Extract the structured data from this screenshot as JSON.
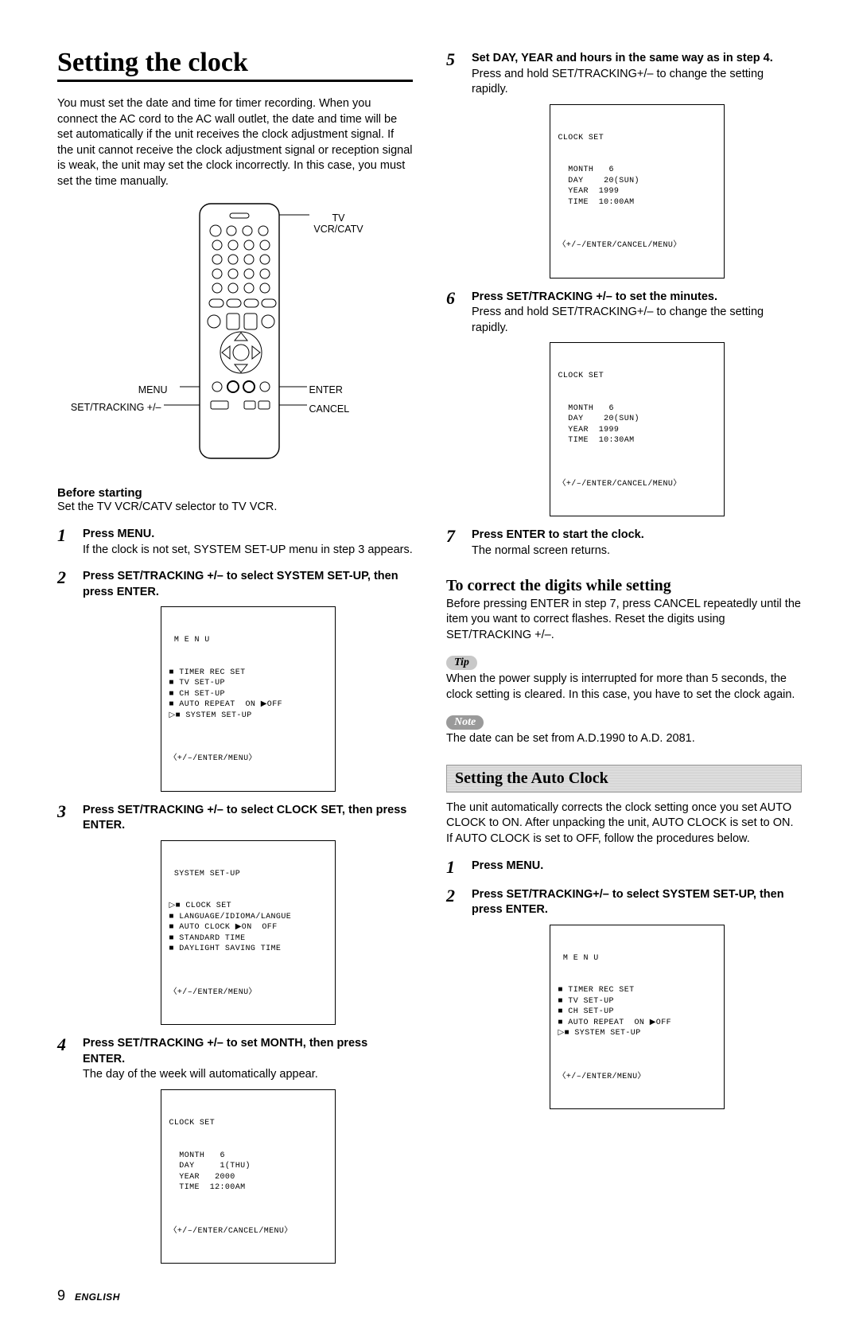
{
  "left": {
    "title": "Setting the clock",
    "intro": "You must set the date and time for timer recording. When you connect the AC cord to the AC wall outlet, the date and time will be set automatically if the unit receives the clock adjustment signal. If the unit cannot receive the clock adjustment signal or reception signal is weak, the unit may set the clock incorrectly. In this case, you must set the time manually.",
    "labels": {
      "tvvcr": "TV VCR/CATV",
      "menu": "MENU",
      "settracking": "SET/TRACKING +/–",
      "enter": "ENTER",
      "cancel": "CANCEL"
    },
    "before_heading": "Before starting",
    "before_text": "Set the TV VCR/CATV selector to TV VCR.",
    "steps": [
      {
        "n": "1",
        "title": "Press MENU.",
        "body": "If the clock is not set, SYSTEM SET-UP menu in step 3 appears."
      },
      {
        "n": "2",
        "title": "Press SET/TRACKING +/– to select SYSTEM SET-UP, then press ENTER.",
        "body": ""
      },
      {
        "n": "3",
        "title": "Press SET/TRACKING +/– to select CLOCK SET, then press ENTER.",
        "body": ""
      },
      {
        "n": "4",
        "title": "Press SET/TRACKING +/– to set MONTH, then press ENTER.",
        "body": "The day of the week will automatically appear."
      }
    ],
    "osd_menu": {
      "head": " M E N U",
      "lines": "■ TIMER REC SET\n■ TV SET-UP\n■ CH SET-UP\n■ AUTO REPEAT  ON ▶OFF\n▷■ SYSTEM SET-UP",
      "footer": "〈+/–/ENTER/MENU〉"
    },
    "osd_system": {
      "head": " SYSTEM SET-UP",
      "lines": "▷■ CLOCK SET\n■ LANGUAGE/IDIOMA/LANGUE\n■ AUTO CLOCK ▶ON  OFF\n■ STANDARD TIME\n■ DAYLIGHT SAVING TIME",
      "footer": "〈+/–/ENTER/MENU〉"
    },
    "osd_clock4": {
      "head": "CLOCK SET",
      "lines": "  MONTH   6\n  DAY     1(THU)\n  YEAR   2000\n  TIME  12:00AM",
      "footer": "〈+/–/ENTER/CANCEL/MENU〉"
    }
  },
  "right": {
    "steps": [
      {
        "n": "5",
        "title": "Set DAY, YEAR and hours in the same way as in step 4.",
        "body": "Press and hold SET/TRACKING+/– to change the setting rapidly."
      },
      {
        "n": "6",
        "title": "Press SET/TRACKING +/– to set the minutes.",
        "body": "Press and hold SET/TRACKING+/– to change the setting rapidly."
      },
      {
        "n": "7",
        "title": "Press ENTER to start the clock.",
        "body": "The normal screen returns."
      }
    ],
    "osd_clock5": {
      "head": "CLOCK SET",
      "lines": "  MONTH   6\n  DAY    20(SUN)\n  YEAR  1999\n  TIME  10:00AM",
      "footer": "〈+/–/ENTER/CANCEL/MENU〉"
    },
    "osd_clock6": {
      "head": "CLOCK SET",
      "lines": "  MONTH   6\n  DAY    20(SUN)\n  YEAR  1999\n  TIME  10:30AM",
      "footer": "〈+/–/ENTER/CANCEL/MENU〉"
    },
    "correct_heading": "To correct the digits while setting",
    "correct_body": "Before pressing ENTER in step 7, press CANCEL repeatedly until the item you want to correct flashes.  Reset the digits using SET/TRACKING +/–.",
    "tip_label": "Tip",
    "tip_body": "When the power supply is interrupted for more than 5 seconds, the clock setting is cleared. In this case, you have to set the clock again.",
    "note_label": "Note",
    "note_body": "The date can be set from A.D.1990 to A.D. 2081.",
    "auto_heading": "Setting the Auto Clock",
    "auto_body": "The unit automatically corrects the clock setting once you set AUTO CLOCK to ON.  After unpacking the unit, AUTO CLOCK is set to ON.\nIf AUTO CLOCK is set to OFF, follow the procedures below.",
    "auto_steps": [
      {
        "n": "1",
        "title": "Press MENU.",
        "body": ""
      },
      {
        "n": "2",
        "title": "Press SET/TRACKING+/– to select SYSTEM SET-UP, then press ENTER.",
        "body": ""
      }
    ],
    "osd_menu2": {
      "head": " M E N U",
      "lines": "■ TIMER REC SET\n■ TV SET-UP\n■ CH SET-UP\n■ AUTO REPEAT  ON ▶OFF\n▷■ SYSTEM SET-UP",
      "footer": "〈+/–/ENTER/MENU〉"
    }
  },
  "page_number": "9",
  "language_label": "ENGLISH"
}
